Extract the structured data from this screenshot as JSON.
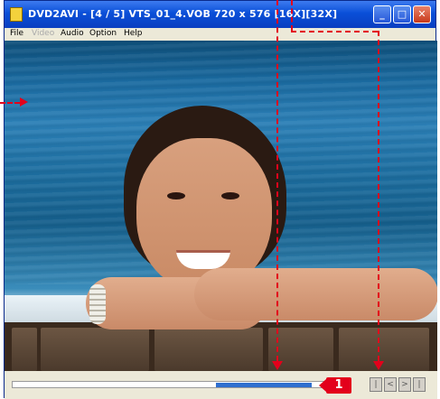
{
  "window": {
    "title": "DVD2AVI - [4 / 5] VTS_01_4.VOB 720 x 576 [16X][32X]",
    "controls": {
      "minimize": "_",
      "maximize": "□",
      "close": "✕"
    }
  },
  "menu": {
    "items": [
      "File",
      "Video",
      "Audio",
      "Option",
      "Help"
    ]
  },
  "annotation": {
    "callout_number": "1",
    "accent_color": "#e3001b"
  },
  "playback": {
    "progress": 0.92,
    "buttons": [
      "|",
      "<",
      ">",
      "|"
    ]
  },
  "icons": [
    "app-icon",
    "minimize-icon",
    "maximize-icon",
    "close-icon"
  ]
}
